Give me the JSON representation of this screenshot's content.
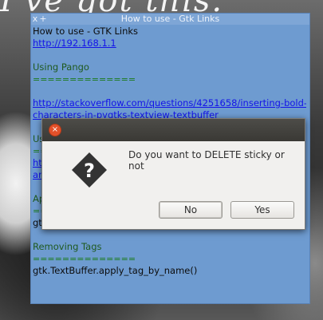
{
  "background": {
    "script_text": "I've got this."
  },
  "sticky": {
    "titlebar": {
      "close_glyph": "x",
      "add_glyph": "+",
      "title": "How to use - Gtk Links"
    },
    "lines": [
      {
        "kind": "text",
        "text": "How to use - GTK Links"
      },
      {
        "kind": "link",
        "text": "http://192.168.1.1"
      },
      {
        "kind": "blank",
        "text": ""
      },
      {
        "kind": "section",
        "text": "Using Pango"
      },
      {
        "kind": "sep",
        "text": "=============="
      },
      {
        "kind": "blank",
        "text": ""
      },
      {
        "kind": "link",
        "text": "http://stackoverflow.com/questions/4251658/inserting-bold-"
      },
      {
        "kind": "link",
        "text": "characters-in-pygtks-textview-textbuffer"
      },
      {
        "kind": "blank",
        "text": ""
      },
      {
        "kind": "section",
        "text": "Us"
      },
      {
        "kind": "sep",
        "text": "=="
      },
      {
        "kind": "link",
        "text": "ht"
      },
      {
        "kind": "link",
        "text": "an"
      },
      {
        "kind": "blank",
        "text": ""
      },
      {
        "kind": "section",
        "text": "Ap"
      },
      {
        "kind": "sep",
        "text": "=="
      },
      {
        "kind": "text",
        "text": "gt"
      },
      {
        "kind": "blank",
        "text": ""
      },
      {
        "kind": "section",
        "text": "Removing Tags"
      },
      {
        "kind": "sep",
        "text": "=============="
      },
      {
        "kind": "text",
        "text": "gtk.TextBuffer.apply_tag_by_name()"
      }
    ]
  },
  "dialog": {
    "close_glyph": "×",
    "icon": "question-icon",
    "message": "Do you want to DELETE sticky or not",
    "buttons": {
      "no_label": "No",
      "yes_label": "Yes"
    }
  }
}
